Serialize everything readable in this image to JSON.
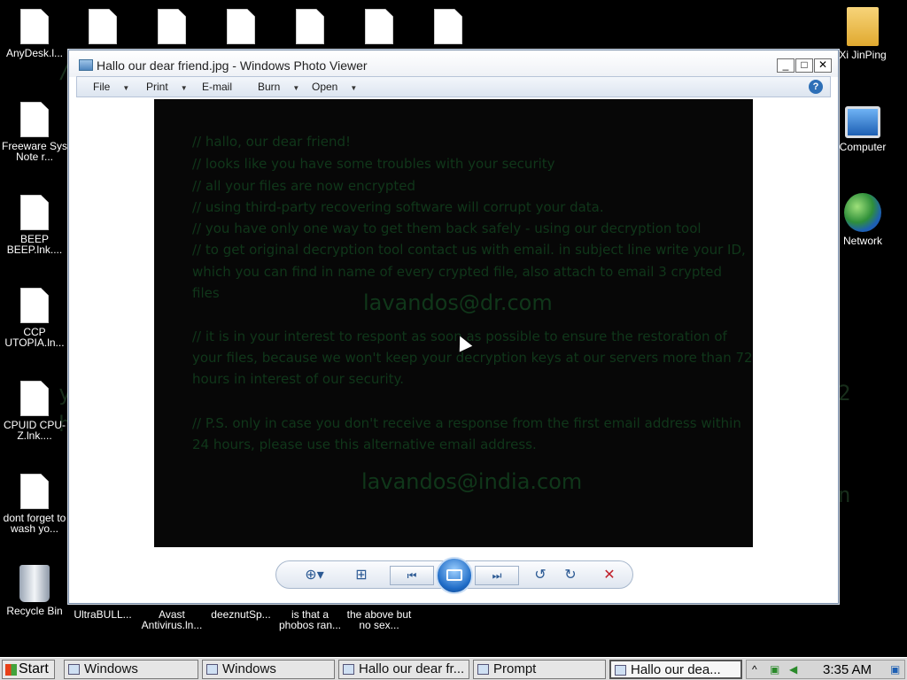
{
  "desktop": {
    "left_icons": [
      {
        "label": "AnyDesk.l..."
      },
      {
        "label": "Freeware Sys Note r..."
      },
      {
        "label": "BEEP BEEP.lnk...."
      },
      {
        "label": "CCP UTOPIA.ln..."
      },
      {
        "label": "CPUID CPU-Z.lnk...."
      },
      {
        "label": "dont forget to wash yo..."
      },
      {
        "label": "Recycle Bin"
      }
    ],
    "bottom_icons": [
      {
        "label": "UltraBULL..."
      },
      {
        "label": "Avast Antivirus.ln..."
      },
      {
        "label": "deeznutSp..."
      },
      {
        "label": "is that a phobos ran..."
      },
      {
        "label": "the above but no sex..."
      }
    ],
    "right_icons": [
      {
        "label": "Xi JinPing"
      },
      {
        "label": "Computer"
      },
      {
        "label": "Network"
      }
    ]
  },
  "window": {
    "title": "Hallo our dear friend.jpg - Windows Photo Viewer",
    "menu": {
      "file": "File",
      "print": "Print",
      "email": "E-mail",
      "burn": "Burn",
      "open": "Open"
    },
    "controls": {
      "minimize": "_",
      "maximize": "□",
      "close": "✕"
    }
  },
  "ransom_note": {
    "lines": [
      "// hallo, our dear friend!",
      "// looks like you have some troubles with your security",
      "// all your files are now encrypted",
      "// using third-party recovering software will corrupt your data.",
      "// you have only one way to get them back safely - using our decryption tool",
      "// to get original decryption tool contact us with email. in subject line write your ID,",
      "which you can find in name of every crypted file, also attach to email 3 crypted files"
    ],
    "email_primary": "lavandos@dr.com",
    "paragraph2": [
      "// it is in your interest to respont as soon as possible to ensure the restoration of",
      "your files, because we won't keep your decryption keys at our servers more than 72",
      "hours in interest of our security."
    ],
    "paragraph3": [
      "// P.S. only in case you don't receive a response from the first email address within",
      "24 hours, please use this alternative email address."
    ],
    "email_alt": "lavandos@india.com"
  },
  "taskbar": {
    "start": "Start",
    "tasks": [
      {
        "label": "Windows"
      },
      {
        "label": "Windows"
      },
      {
        "label": "Hallo our dear fr..."
      },
      {
        "label": "Prompt"
      },
      {
        "label": "Hallo our dea..."
      }
    ],
    "time": "3:35 AM"
  }
}
